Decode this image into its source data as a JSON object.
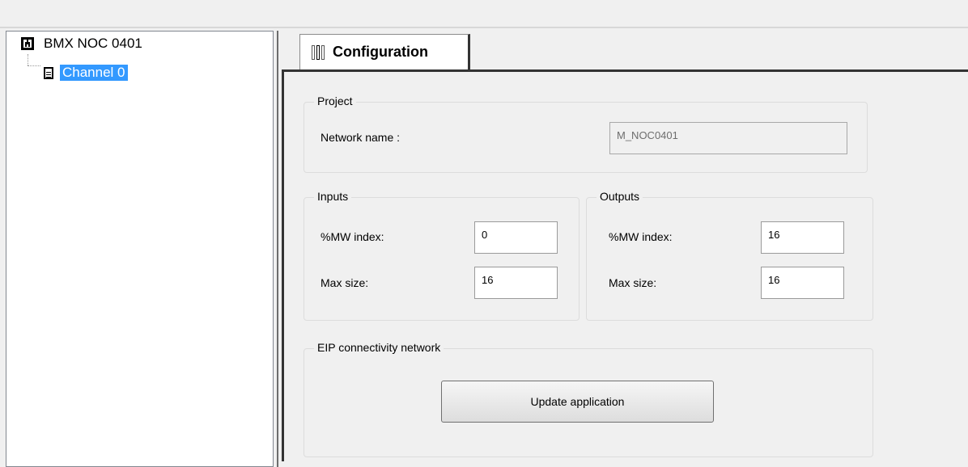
{
  "tree": {
    "root_label": "BMX NOC 0401",
    "child_label": "Channel 0"
  },
  "tab": {
    "label": "Configuration"
  },
  "project": {
    "legend": "Project",
    "network_name_label": "Network name :",
    "network_name_value": "M_NOC0401"
  },
  "inputs": {
    "legend": "Inputs",
    "mw_index_label": "%MW index:",
    "mw_index_value": "0",
    "max_size_label": "Max size:",
    "max_size_value": "16"
  },
  "outputs": {
    "legend": "Outputs",
    "mw_index_label": "%MW index:",
    "mw_index_value": "16",
    "max_size_label": "Max size:",
    "max_size_value": "16"
  },
  "eip": {
    "legend": "EIP connectivity network",
    "update_button_label": "Update application"
  }
}
